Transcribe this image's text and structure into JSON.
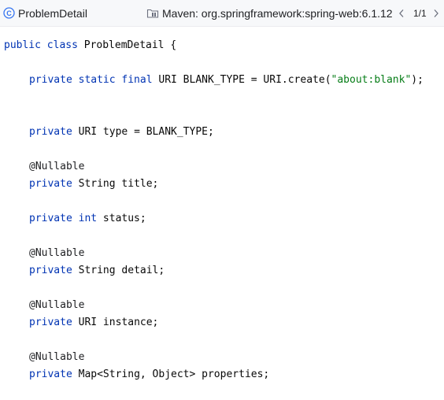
{
  "header": {
    "title": "ProblemDetail",
    "library": "Maven: org.springframework:spring-web:6.1.12",
    "counter": "1/1",
    "class_icon_letter": "C",
    "class_icon_color": "#3574f0"
  },
  "code": {
    "l1": {
      "kw": "public class",
      "rest": " ProblemDetail {"
    },
    "l2": {
      "kw": "private static final",
      "mid": " URI BLANK_TYPE = URI.create(",
      "str": "\"about:blank\"",
      "end": ");"
    },
    "l3": {
      "kw": "private",
      "rest": " URI type = BLANK_TYPE;"
    },
    "l4": {
      "ann": "@Nullable"
    },
    "l5": {
      "kw": "private",
      "rest": " String title;"
    },
    "l6": {
      "kw": "private int",
      "rest": " status;"
    },
    "l7": {
      "ann": "@Nullable"
    },
    "l8": {
      "kw": "private",
      "rest": " String detail;"
    },
    "l9": {
      "ann": "@Nullable"
    },
    "l10": {
      "kw": "private",
      "rest": " URI instance;"
    },
    "l11": {
      "ann": "@Nullable"
    },
    "l12": {
      "kw": "private",
      "rest": " Map<String, Object> properties;"
    }
  }
}
